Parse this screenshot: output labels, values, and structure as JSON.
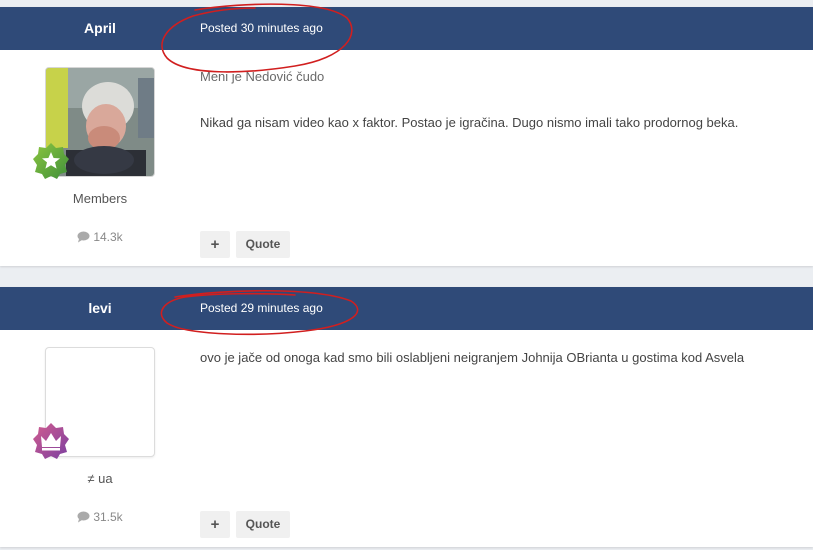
{
  "posts": [
    {
      "author": "April",
      "posted": "Posted 30 minutes ago",
      "group": "Members",
      "post_count": "14.3k",
      "quote_text": "Meni je Nedović čudo",
      "message": "Nikad ga nisam video kao x faktor. Postao je igračina. Dugo nismo imali tako prodornog beka.",
      "badge_icon": "star-icon",
      "plus_label": "+",
      "quote_label": "Quote"
    },
    {
      "author": "levi",
      "posted": "Posted 29 minutes ago",
      "group": "≠ ua",
      "post_count": "31.5k",
      "message": "ovo je jače od onoga kad smo bili oslabljeni neigranjem Johnija OBrianta u gostima kod Asvela",
      "badge_icon": "crown-icon",
      "plus_label": "+",
      "quote_label": "Quote"
    }
  ],
  "colors": {
    "header_bg": "#2f4a78",
    "annotation": "#d11f1f",
    "badge_green": "#6fae3b",
    "badge_purple": "#b1408f"
  }
}
